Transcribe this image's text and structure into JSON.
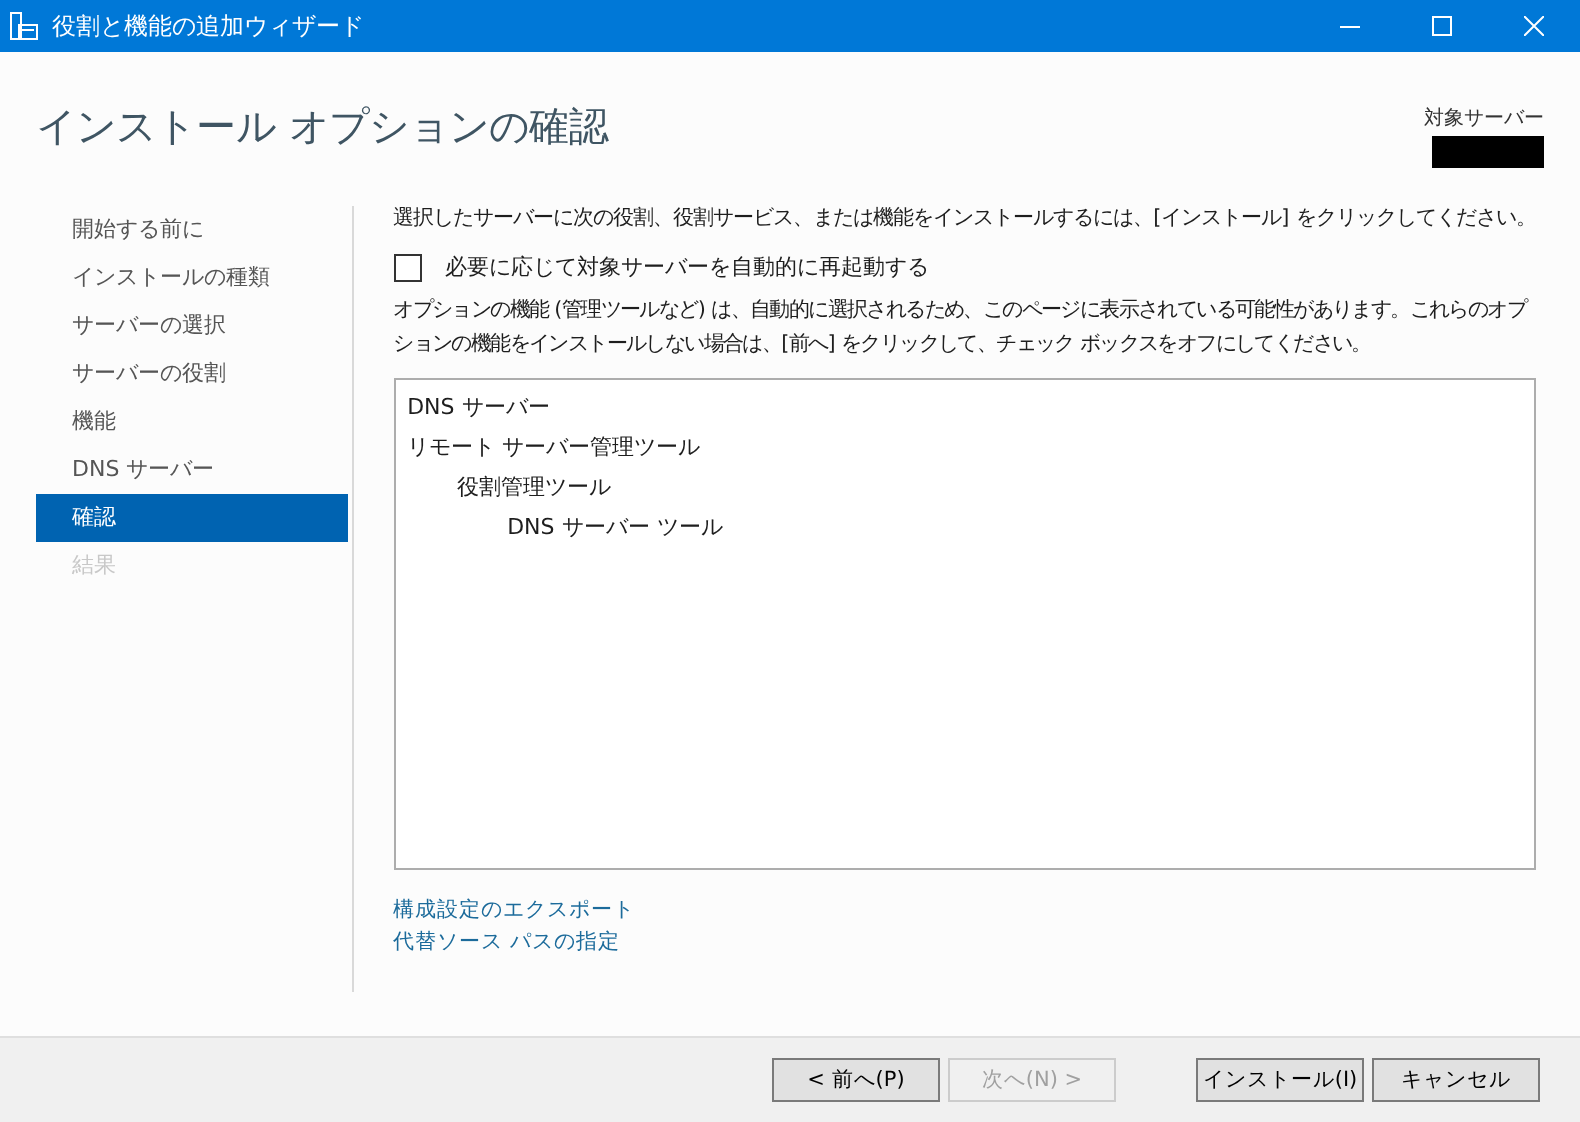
{
  "window": {
    "title": "役割と機能の追加ウィザード"
  },
  "header": {
    "title": "インストール オプションの確認",
    "target_server_label": "対象サーバー"
  },
  "sidebar": {
    "items": [
      {
        "label": "開始する前に",
        "selected": false,
        "disabled": false
      },
      {
        "label": "インストールの種類",
        "selected": false,
        "disabled": false
      },
      {
        "label": "サーバーの選択",
        "selected": false,
        "disabled": false
      },
      {
        "label": "サーバーの役割",
        "selected": false,
        "disabled": false
      },
      {
        "label": "機能",
        "selected": false,
        "disabled": false
      },
      {
        "label": "DNS サーバー",
        "selected": false,
        "disabled": false
      },
      {
        "label": "確認",
        "selected": true,
        "disabled": false
      },
      {
        "label": "結果",
        "selected": false,
        "disabled": true
      }
    ]
  },
  "content": {
    "intro": "選択したサーバーに次の役割、役割サービス、または機能をインストールするには、[インストール] をクリックしてください。",
    "restart_checkbox": {
      "label": "必要に応じて対象サーバーを自動的に再起動する",
      "checked": false
    },
    "note": "オプションの機能 (管理ツールなど) は、自動的に選択されるため、このページに表示されている可能性があります。これらのオプションの機能をインストールしない場合は、[前へ] をクリックして、チェック ボックスをオフにしてください。",
    "selection": [
      {
        "label": "DNS サーバー"
      },
      {
        "label": "リモート サーバー管理ツール",
        "children": [
          {
            "label": "役割管理ツール",
            "children": [
              {
                "label": "DNS サーバー ツール"
              }
            ]
          }
        ]
      }
    ],
    "links": [
      "構成設定のエクスポート",
      "代替ソース パスの指定"
    ]
  },
  "buttons": [
    {
      "label": "< 前へ(P)",
      "disabled": false
    },
    {
      "label": "次へ(N) >",
      "disabled": true
    },
    {
      "label": "インストール(I)",
      "disabled": false
    },
    {
      "label": "キャンセル",
      "disabled": false
    }
  ]
}
